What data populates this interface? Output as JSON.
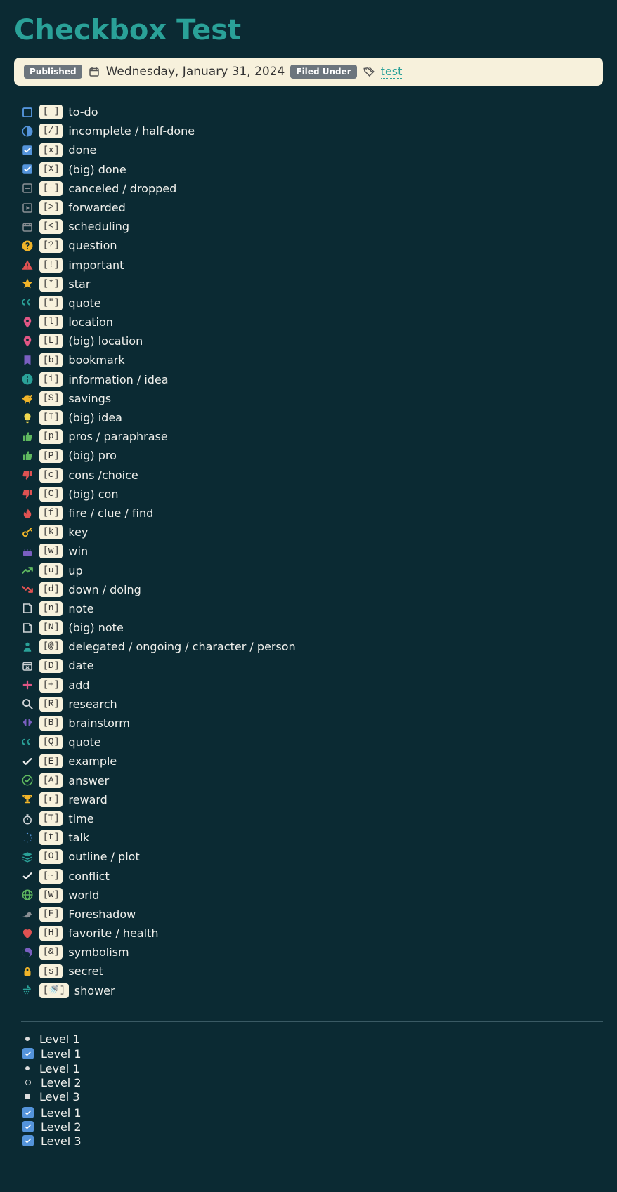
{
  "title": "Checkbox Test",
  "meta": {
    "published_label": "Published",
    "date": "Wednesday, January 31, 2024",
    "filed_under_label": "Filed Under",
    "tag": "test"
  },
  "items": [
    {
      "icon": "square-empty",
      "icon_color": "#5494db",
      "code": "[ ]",
      "label": "to-do"
    },
    {
      "icon": "half-circle",
      "icon_color": "#5494db",
      "code": "[/]",
      "label": "incomplete / half-done"
    },
    {
      "icon": "check-filled",
      "icon_color": "#5494db",
      "code": "[x]",
      "label": "done"
    },
    {
      "icon": "check-filled",
      "icon_color": "#5494db",
      "code": "[X]",
      "label": "(big) done"
    },
    {
      "icon": "minus-box",
      "icon_color": "#8a8f94",
      "code": "[-]",
      "label": "canceled / dropped"
    },
    {
      "icon": "play-box",
      "icon_color": "#8a8f94",
      "code": "[>]",
      "label": "forwarded"
    },
    {
      "icon": "calendar",
      "icon_color": "#8a8f94",
      "code": "[<]",
      "label": "scheduling"
    },
    {
      "icon": "question-circle",
      "icon_color": "#f0b429",
      "code": "[?]",
      "label": "question"
    },
    {
      "icon": "warning",
      "icon_color": "#e05252",
      "code": "[!]",
      "label": "important"
    },
    {
      "icon": "star",
      "icon_color": "#f0b429",
      "code": "[*]",
      "label": "star"
    },
    {
      "icon": "quote",
      "icon_color": "#2aa198",
      "code": "[\"]",
      "label": "quote"
    },
    {
      "icon": "pin",
      "icon_color": "#e05684",
      "code": "[l]",
      "label": "location"
    },
    {
      "icon": "pin",
      "icon_color": "#e05684",
      "code": "[L]",
      "label": "(big) location"
    },
    {
      "icon": "bookmark",
      "icon_color": "#7a5fc1",
      "code": "[b]",
      "label": "bookmark"
    },
    {
      "icon": "info-circle",
      "icon_color": "#2aa198",
      "code": "[i]",
      "label": "information / idea"
    },
    {
      "icon": "piggy",
      "icon_color": "#f0b429",
      "code": "[S]",
      "label": "savings"
    },
    {
      "icon": "bulb",
      "icon_color": "#f0d84f",
      "code": "[I]",
      "label": "(big) idea"
    },
    {
      "icon": "thumbs-up",
      "icon_color": "#5fb85f",
      "code": "[p]",
      "label": "pros / paraphrase"
    },
    {
      "icon": "thumbs-up",
      "icon_color": "#5fb85f",
      "code": "[P]",
      "label": "(big) pro"
    },
    {
      "icon": "thumbs-down",
      "icon_color": "#e05252",
      "code": "[c]",
      "label": "cons /choice"
    },
    {
      "icon": "thumbs-down",
      "icon_color": "#e05252",
      "code": "[C]",
      "label": "(big) con"
    },
    {
      "icon": "fire",
      "icon_color": "#e05252",
      "code": "[f]",
      "label": "fire / clue / find"
    },
    {
      "icon": "key",
      "icon_color": "#f0b429",
      "code": "[k]",
      "label": "key"
    },
    {
      "icon": "cake",
      "icon_color": "#7a5fc1",
      "code": "[w]",
      "label": "win"
    },
    {
      "icon": "trend-up",
      "icon_color": "#5fb85f",
      "code": "[u]",
      "label": "up"
    },
    {
      "icon": "trend-down",
      "icon_color": "#e05252",
      "code": "[d]",
      "label": "down / doing"
    },
    {
      "icon": "note",
      "icon_color": "#cfd3d6",
      "code": "[n]",
      "label": "note"
    },
    {
      "icon": "note",
      "icon_color": "#cfd3d6",
      "code": "[N]",
      "label": "(big) note"
    },
    {
      "icon": "person",
      "icon_color": "#2aa198",
      "code": "[@]",
      "label": "delegated / ongoing / character / person"
    },
    {
      "icon": "calendar-x",
      "icon_color": "#cfd3d6",
      "code": "[D]",
      "label": "date"
    },
    {
      "icon": "plus",
      "icon_color": "#e05684",
      "code": "[+]",
      "label": "add"
    },
    {
      "icon": "search",
      "icon_color": "#cfd3d6",
      "code": "[R]",
      "label": "research"
    },
    {
      "icon": "brain",
      "icon_color": "#7a5fc1",
      "code": "[B]",
      "label": "brainstorm"
    },
    {
      "icon": "quote",
      "icon_color": "#2aa198",
      "code": "[Q]",
      "label": "quote"
    },
    {
      "icon": "check",
      "icon_color": "#eeeeee",
      "code": "[E]",
      "label": "example"
    },
    {
      "icon": "check-circle",
      "icon_color": "#5fb85f",
      "code": "[A]",
      "label": "answer"
    },
    {
      "icon": "trophy",
      "icon_color": "#f0b429",
      "code": "[r]",
      "label": "reward"
    },
    {
      "icon": "stopwatch",
      "icon_color": "#cfd3d6",
      "code": "[T]",
      "label": "time"
    },
    {
      "icon": "spinner",
      "icon_color": "#5494db",
      "code": "[t]",
      "label": "talk"
    },
    {
      "icon": "layers",
      "icon_color": "#2aa198",
      "code": "[O]",
      "label": "outline / plot"
    },
    {
      "icon": "check",
      "icon_color": "#eeeeee",
      "code": "[~]",
      "label": "conflict"
    },
    {
      "icon": "globe",
      "icon_color": "#5fb85f",
      "code": "[W]",
      "label": "world"
    },
    {
      "icon": "bird",
      "icon_color": "#8a8f94",
      "code": "[F]",
      "label": "Foreshadow"
    },
    {
      "icon": "heart",
      "icon_color": "#e05252",
      "code": "[H]",
      "label": "favorite / health"
    },
    {
      "icon": "yinyang",
      "icon_color": "#7a5fc1",
      "code": "[&]",
      "label": "symbolism"
    },
    {
      "icon": "lock",
      "icon_color": "#f0b429",
      "code": "[s]",
      "label": "secret"
    },
    {
      "icon": "shower",
      "icon_color": "#2aa198",
      "code": "[🚿]",
      "label": "shower"
    }
  ],
  "nested": {
    "l1": "Level 1",
    "l2": "Level 2",
    "l3": "Level 3"
  }
}
